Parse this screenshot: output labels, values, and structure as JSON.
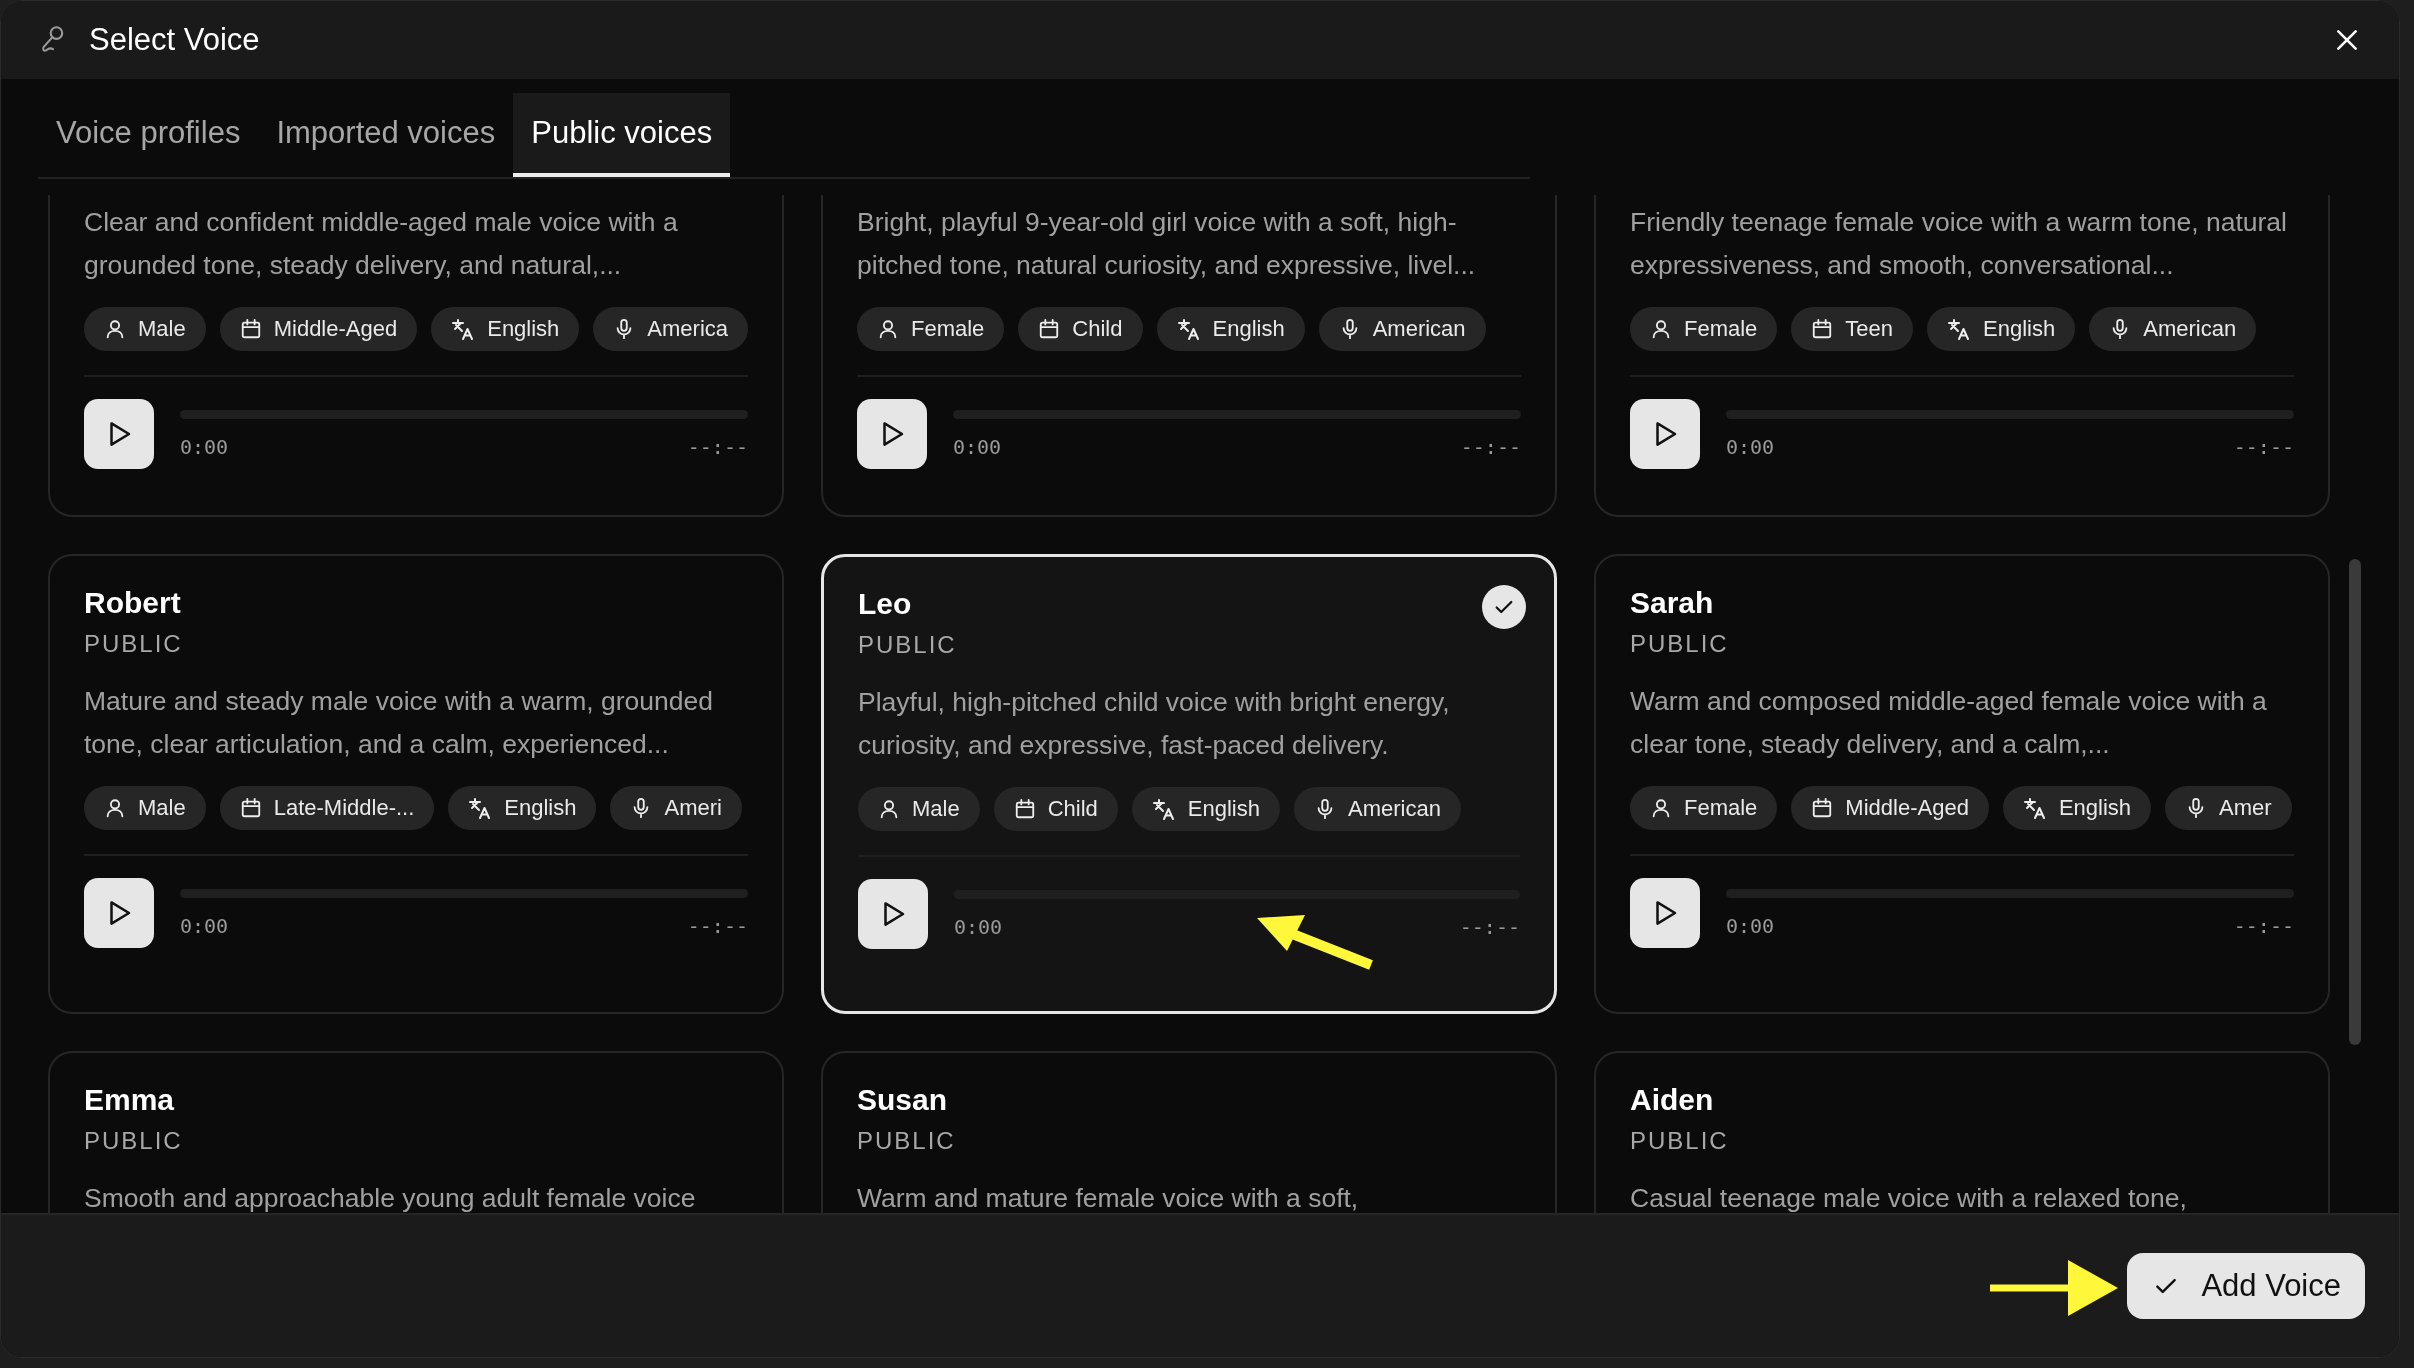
{
  "dialog": {
    "title": "Select Voice"
  },
  "tabs": [
    {
      "label": "Voice profiles",
      "selected": false
    },
    {
      "label": "Imported voices",
      "selected": false
    },
    {
      "label": "Public voices",
      "selected": true
    }
  ],
  "voices": [
    {
      "description": "Clear and confident middle-aged male voice with a grounded tone, steady delivery, and natural,...",
      "tags": [
        {
          "kind": "gender",
          "label": "Male"
        },
        {
          "kind": "age",
          "label": "Middle-Aged"
        },
        {
          "kind": "language",
          "label": "English"
        },
        {
          "kind": "accent",
          "label": "America"
        }
      ],
      "player": {
        "elapsed": "0:00",
        "duration": "--:--"
      },
      "selected": false
    },
    {
      "description": "Bright, playful 9-year-old girl voice with a soft, high-pitched tone, natural curiosity, and expressive, livel...",
      "tags": [
        {
          "kind": "gender",
          "label": "Female"
        },
        {
          "kind": "age",
          "label": "Child"
        },
        {
          "kind": "language",
          "label": "English"
        },
        {
          "kind": "accent",
          "label": "American"
        }
      ],
      "player": {
        "elapsed": "0:00",
        "duration": "--:--"
      },
      "selected": false
    },
    {
      "description": "Friendly teenage female voice with a warm tone, natural expressiveness, and smooth, conversational...",
      "tags": [
        {
          "kind": "gender",
          "label": "Female"
        },
        {
          "kind": "age",
          "label": "Teen"
        },
        {
          "kind": "language",
          "label": "English"
        },
        {
          "kind": "accent",
          "label": "American"
        }
      ],
      "player": {
        "elapsed": "0:00",
        "duration": "--:--"
      },
      "selected": false
    },
    {
      "name": "Robert",
      "visibility": "PUBLIC",
      "description": "Mature and steady male voice with a warm, grounded tone, clear articulation, and a calm, experienced...",
      "tags": [
        {
          "kind": "gender",
          "label": "Male"
        },
        {
          "kind": "age",
          "label": "Late-Middle-..."
        },
        {
          "kind": "language",
          "label": "English"
        },
        {
          "kind": "accent",
          "label": "Ameri"
        }
      ],
      "player": {
        "elapsed": "0:00",
        "duration": "--:--"
      },
      "selected": false
    },
    {
      "name": "Leo",
      "visibility": "PUBLIC",
      "description": "Playful, high-pitched child voice with bright energy, curiosity, and expressive, fast-paced delivery.",
      "tags": [
        {
          "kind": "gender",
          "label": "Male"
        },
        {
          "kind": "age",
          "label": "Child"
        },
        {
          "kind": "language",
          "label": "English"
        },
        {
          "kind": "accent",
          "label": "American"
        }
      ],
      "player": {
        "elapsed": "0:00",
        "duration": "--:--"
      },
      "selected": true
    },
    {
      "name": "Sarah",
      "visibility": "PUBLIC",
      "description": "Warm and composed middle-aged female voice with a clear tone, steady delivery, and a calm,...",
      "tags": [
        {
          "kind": "gender",
          "label": "Female"
        },
        {
          "kind": "age",
          "label": "Middle-Aged"
        },
        {
          "kind": "language",
          "label": "English"
        },
        {
          "kind": "accent",
          "label": "Amer"
        }
      ],
      "player": {
        "elapsed": "0:00",
        "duration": "--:--"
      },
      "selected": false
    },
    {
      "name": "Emma",
      "visibility": "PUBLIC",
      "description": "Smooth and approachable young adult female voice",
      "selected": false
    },
    {
      "name": "Susan",
      "visibility": "PUBLIC",
      "description": "Warm and mature female voice with a soft,",
      "selected": false
    },
    {
      "name": "Aiden",
      "visibility": "PUBLIC",
      "description": "Casual teenage male voice with a relaxed tone,",
      "selected": false
    }
  ],
  "footer": {
    "button": "Add Voice"
  }
}
